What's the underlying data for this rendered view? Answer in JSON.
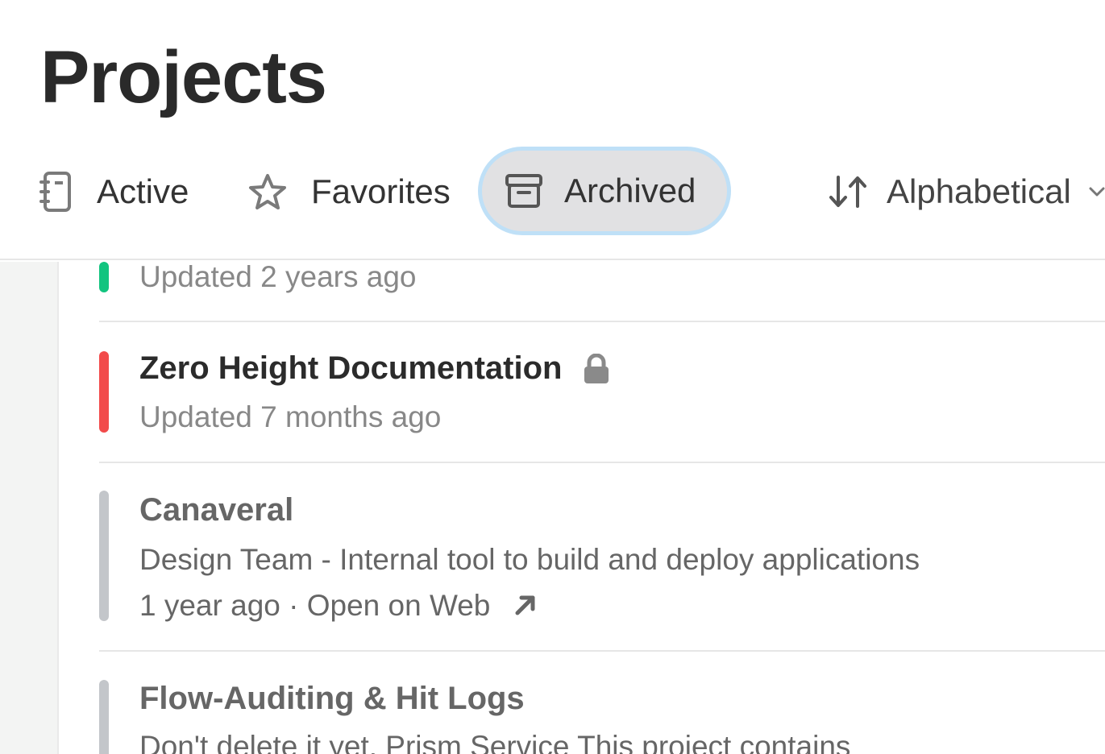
{
  "header": {
    "title": "Projects",
    "tabs": [
      {
        "label": "Active",
        "icon": "notebook-icon",
        "selected": false
      },
      {
        "label": "Favorites",
        "icon": "star-icon",
        "selected": false
      },
      {
        "label": "Archived",
        "icon": "archive-box-icon",
        "selected": true
      }
    ],
    "sort": {
      "label": "Alphabetical",
      "icon": "sort-arrows-icon"
    }
  },
  "projects": [
    {
      "title": "",
      "updated": "Updated 2 years ago",
      "status_color": "#12c47f"
    },
    {
      "title": "Zero Height Documentation",
      "locked": true,
      "updated": "Updated 7 months ago",
      "status_color": "#f24a4a"
    },
    {
      "title": "Canaveral",
      "description": "Design Team - Internal tool to build and deploy applications",
      "age": "1 year ago",
      "separator": "·",
      "link": "Open on Web",
      "status_color": "#c3c6ca"
    },
    {
      "title": "Flow-Auditing & Hit Logs",
      "description": "Don't delete it yet. Prism Service This project contains",
      "status_color": "#c3c6ca"
    }
  ],
  "colors": {
    "accent_selected_bg": "#e1e1e3",
    "focus_ring": "#bfe0f7",
    "green": "#12c47f",
    "red": "#f24a4a",
    "gray_bar": "#c3c6ca"
  }
}
